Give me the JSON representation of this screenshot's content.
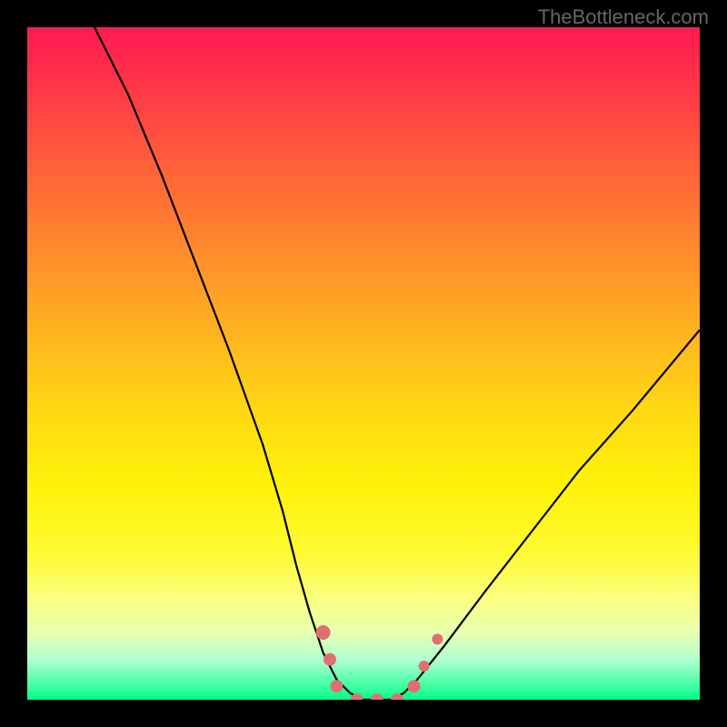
{
  "watermark": "TheBottleneck.com",
  "chart_data": {
    "type": "line",
    "title": "",
    "xlabel": "",
    "ylabel": "",
    "xlim": [
      0,
      100
    ],
    "ylim": [
      0,
      100
    ],
    "series": [
      {
        "name": "bottleneck-curve",
        "x": [
          10,
          15,
          20,
          25,
          30,
          35,
          38,
          40,
          42,
          44,
          46,
          48,
          50,
          52,
          54,
          56,
          58,
          62,
          68,
          75,
          82,
          90,
          100
        ],
        "y": [
          100,
          90,
          78,
          65,
          52,
          38,
          28,
          20,
          13,
          7,
          3,
          1,
          0,
          0,
          0,
          1,
          3,
          8,
          16,
          25,
          34,
          43,
          55
        ]
      }
    ],
    "markers": [
      {
        "x": 44,
        "y": 10,
        "r": 8
      },
      {
        "x": 45,
        "y": 6,
        "r": 7
      },
      {
        "x": 46,
        "y": 2,
        "r": 7
      },
      {
        "x": 49,
        "y": 0,
        "r": 7
      },
      {
        "x": 52,
        "y": 0,
        "r": 7
      },
      {
        "x": 55,
        "y": 0,
        "r": 7
      },
      {
        "x": 57.5,
        "y": 2,
        "r": 7
      },
      {
        "x": 59,
        "y": 5,
        "r": 6
      },
      {
        "x": 61,
        "y": 9,
        "r": 6
      }
    ],
    "gradient_stops": [
      {
        "pct": 0,
        "color": "#ff1a52"
      },
      {
        "pct": 50,
        "color": "#ffd000"
      },
      {
        "pct": 88,
        "color": "#f8ff70"
      },
      {
        "pct": 100,
        "color": "#00ff88"
      }
    ]
  }
}
